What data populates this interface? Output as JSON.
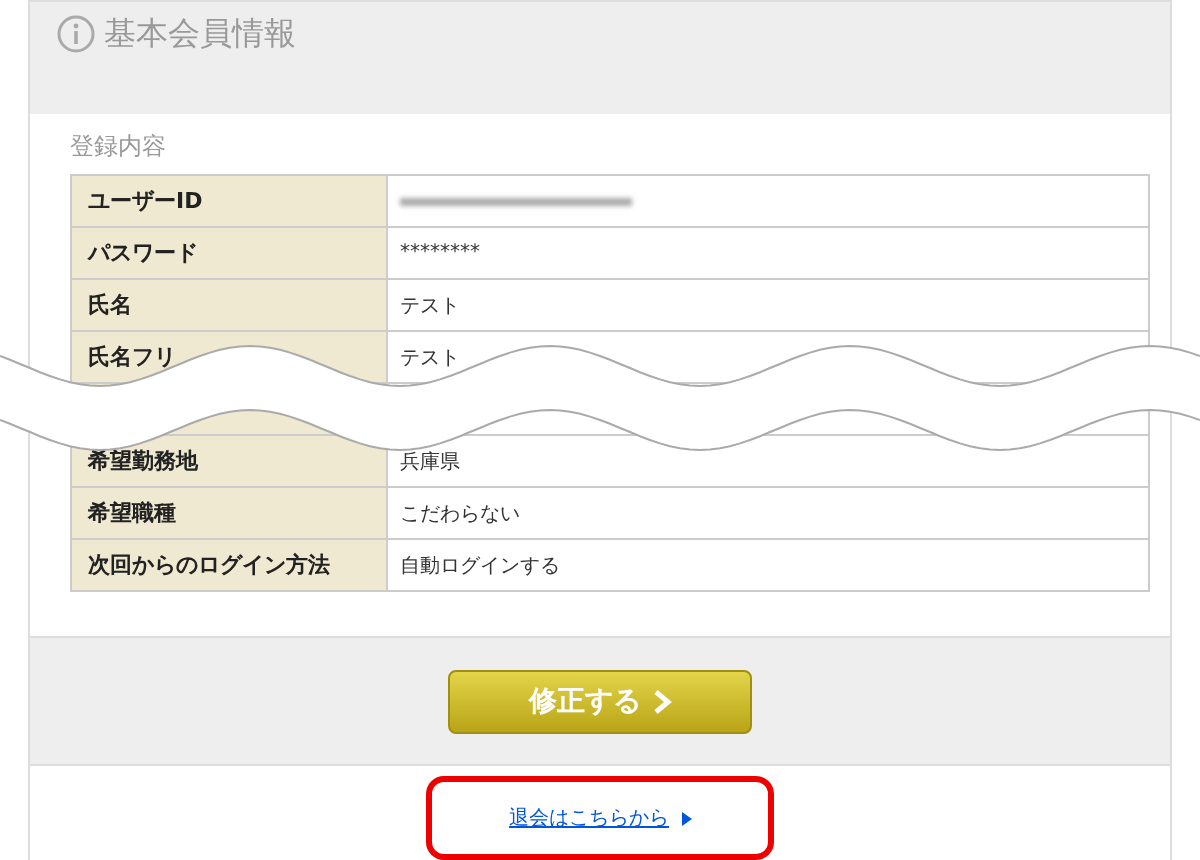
{
  "header": {
    "title": "基本会員情報"
  },
  "section": {
    "title": "登録内容",
    "rows": [
      {
        "label": "ユーザーID",
        "kind": "blurred"
      },
      {
        "label": "パスワード",
        "kind": "text",
        "value": "********"
      },
      {
        "label": "氏名",
        "kind": "text",
        "value": "テスト"
      },
      {
        "label": "氏名フリ",
        "kind": "text",
        "value": "テスト"
      },
      {
        "kind": "hidden"
      },
      {
        "label": "希望勤務地",
        "kind": "text",
        "value": "兵庫県"
      },
      {
        "label": "希望職種",
        "kind": "text",
        "value": "こだわらない"
      },
      {
        "label": "次回からのログイン方法",
        "kind": "text",
        "value": "自動ログインする"
      }
    ]
  },
  "edit_button": {
    "label": "修正する"
  },
  "withdraw_link": {
    "label": "退会はこちらから",
    "highlighted": true
  }
}
